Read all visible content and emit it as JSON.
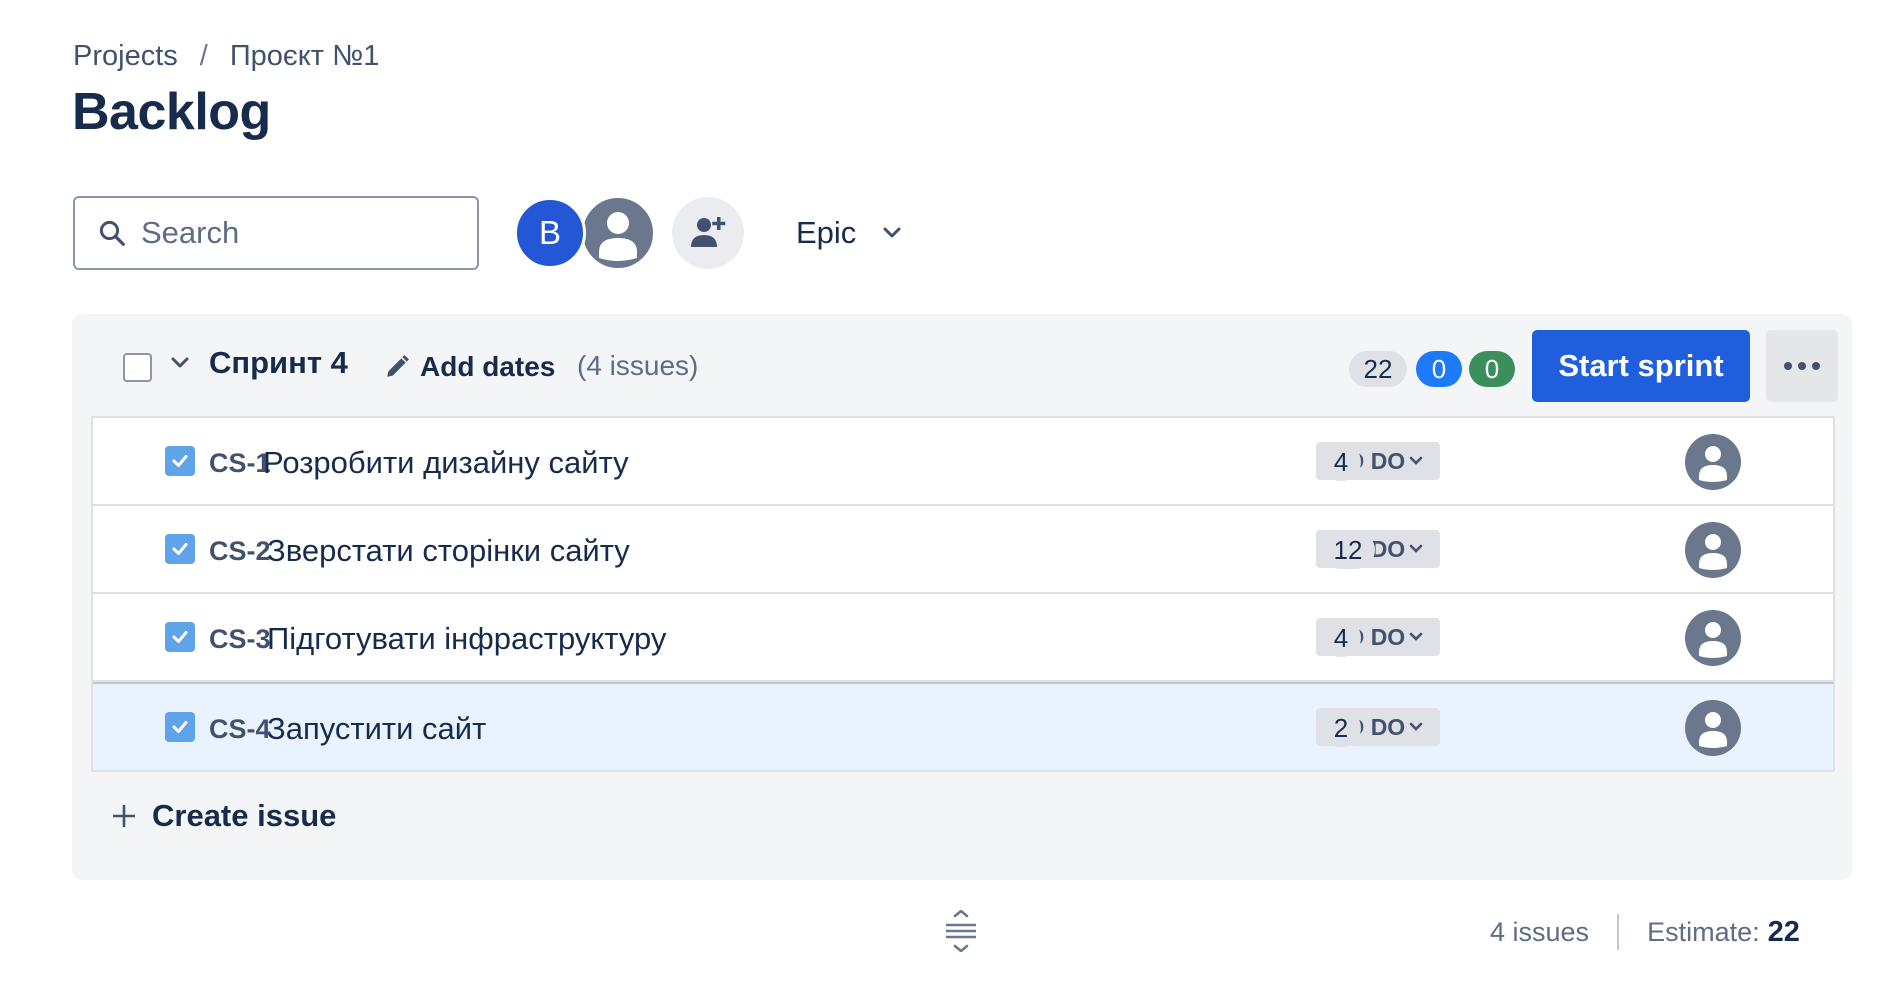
{
  "breadcrumb": {
    "root": "Projects",
    "separator": "/",
    "project": "Проєкт №1"
  },
  "page_title": "Backlog",
  "toolbar": {
    "search_placeholder": "Search",
    "avatar_initial": "B",
    "epic_label": "Epic"
  },
  "sprint": {
    "name": "Спринт 4",
    "add_dates": "Add dates",
    "issue_count": "(4 issues)",
    "points_total": "22",
    "points_in_progress": "0",
    "points_done": "0",
    "start_button": "Start sprint",
    "issues": [
      {
        "key": "CS-1",
        "summary": "Розробити дизайну сайту",
        "status": "TO DO",
        "points": "4"
      },
      {
        "key": "CS-2",
        "summary": "Зверстати сторінки сайту",
        "status": "TO DO",
        "points": "12"
      },
      {
        "key": "CS-3",
        "summary": "Підготувати інфраструктуру",
        "status": "TO DO",
        "points": "4"
      },
      {
        "key": "CS-4",
        "summary": "Запустити сайт",
        "status": "TO DO",
        "points": "2"
      }
    ],
    "create_issue": "Create issue"
  },
  "footer": {
    "issues": "4 issues",
    "estimate_label": "Estimate:",
    "estimate_value": "22"
  },
  "colors": {
    "primary": "#1f5fde",
    "avatar_blue": "#2357d6",
    "pill_blue": "#1d7afc",
    "pill_green": "#3b8f5c",
    "selected_row": "#e9f2ff"
  }
}
